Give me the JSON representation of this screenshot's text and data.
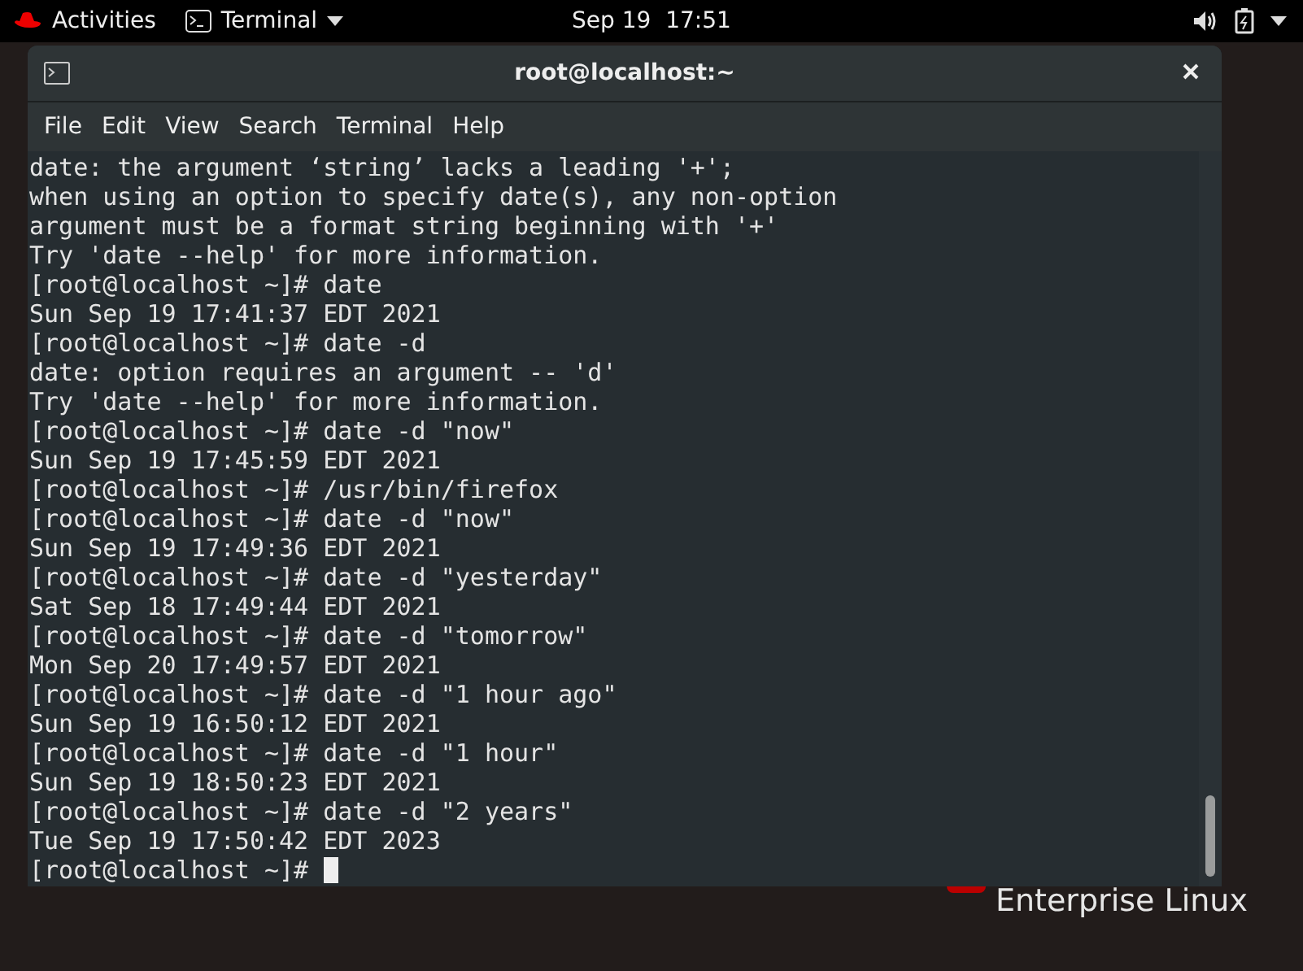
{
  "top_bar": {
    "activities": "Activities",
    "app_menu": "Terminal",
    "clock": "Sep 19  17:51"
  },
  "window": {
    "title": "root@localhost:~"
  },
  "menu": [
    "File",
    "Edit",
    "View",
    "Search",
    "Terminal",
    "Help"
  ],
  "terminal": {
    "lines": [
      "date: the argument ‘string’ lacks a leading '+';",
      "when using an option to specify date(s), any non-option",
      "argument must be a format string beginning with '+'",
      "Try 'date --help' for more information.",
      "[root@localhost ~]# date",
      "Sun Sep 19 17:41:37 EDT 2021",
      "[root@localhost ~]# date -d",
      "date: option requires an argument -- 'd'",
      "Try 'date --help' for more information.",
      "[root@localhost ~]# date -d \"now\"",
      "Sun Sep 19 17:45:59 EDT 2021",
      "[root@localhost ~]# /usr/bin/firefox",
      "[root@localhost ~]# date -d \"now\"",
      "Sun Sep 19 17:49:36 EDT 2021",
      "[root@localhost ~]# date -d \"yesterday\"",
      "Sat Sep 18 17:49:44 EDT 2021",
      "[root@localhost ~]# date -d \"tomorrow\"",
      "Mon Sep 20 17:49:57 EDT 2021",
      "[root@localhost ~]# date -d \"1 hour ago\"",
      "Sun Sep 19 16:50:12 EDT 2021",
      "[root@localhost ~]# date -d \"1 hour\"",
      "Sun Sep 19 18:50:23 EDT 2021",
      "[root@localhost ~]# date -d \"2 years\"",
      "Tue Sep 19 17:50:42 EDT 2023"
    ],
    "prompt": "[root@localhost ~]#"
  },
  "wallpaper": {
    "brand_text": "Enterprise Linux"
  }
}
